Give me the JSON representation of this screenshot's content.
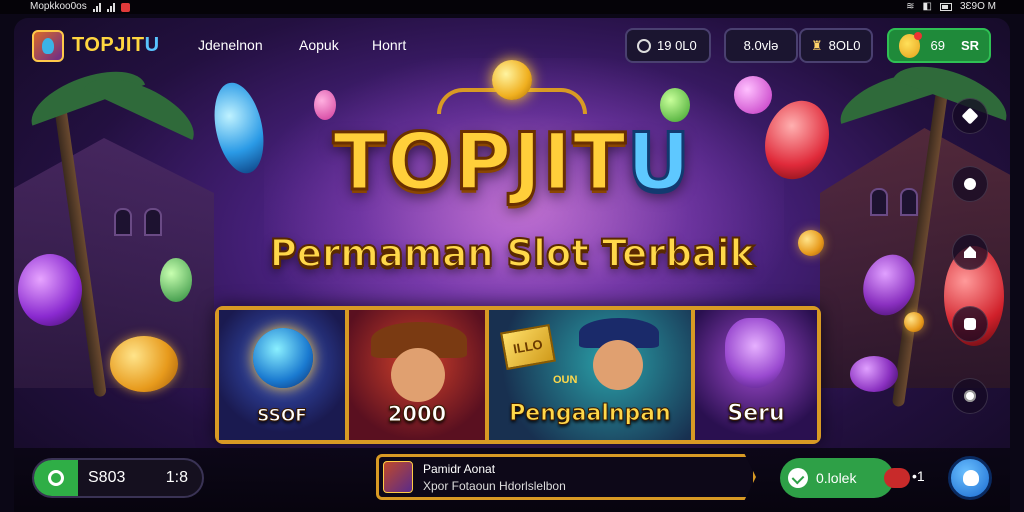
{
  "status_bar": {
    "left_text": "Mopkkoo0os",
    "right_text": "3Ɛ9O M"
  },
  "header": {
    "brand_part1": "TOPJIT",
    "brand_part2": "U",
    "nav": [
      "Jdenelnon",
      "Aopuk",
      "Honrt"
    ],
    "pill_1": "19 0L0",
    "pill_2": "8.0vlə",
    "pill_3": "8OL0",
    "pill_4_value": "69",
    "pill_4_label": "SR"
  },
  "hero": {
    "title_part1": "TOPJIT",
    "title_part2": "U",
    "subtitle": "Permaman Slot Terbaik"
  },
  "cards": [
    {
      "label": "SSOF"
    },
    {
      "label": "2000"
    },
    {
      "label": "Pengaalnpan",
      "tag": "ILLO",
      "tag2": "OUN"
    },
    {
      "label": "Seru"
    }
  ],
  "bottom_bar": {
    "wallet_value": "S803",
    "wallet_ratio": "1:8",
    "ticker_title": "Pamidr Aonat",
    "ticker_sub": "Xpor Fotaoun Hdorlslelbon",
    "green_button": "0.lolek",
    "count": "•1"
  },
  "icons": {
    "logo": "game-logo-icon",
    "pill_1": "coin-icon",
    "pill_2": "none",
    "pill_3": "trophy-icon",
    "pill_4": "avatar-icon",
    "side": [
      "wrench-icon",
      "share-icon",
      "home-icon",
      "chat-icon",
      "settings-icon"
    ],
    "wallet": "refresh-icon",
    "green_button": "check-icon",
    "fab": "support-icon"
  },
  "colors": {
    "brand_gold": "#ffd640",
    "brand_blue": "#59c4ff",
    "accent_green": "#2ea047",
    "frame_gold": "#d89a24"
  }
}
